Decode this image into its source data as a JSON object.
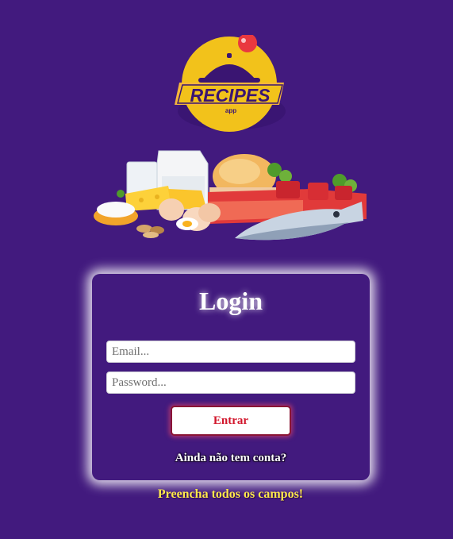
{
  "logo": {
    "title": "RECIPES",
    "subtitle": "app",
    "icon": "cloche-heart-logo"
  },
  "hero": {
    "icon": "food-groceries-illustration"
  },
  "login": {
    "title": "Login",
    "email_placeholder": "Email...",
    "password_placeholder": "Password...",
    "submit_label": "Entrar",
    "signup_text": "Ainda não tem conta?"
  },
  "warning": "Preencha todos os campos!",
  "colors": {
    "background": "#421a7e",
    "logo_yellow": "#f2c21b",
    "button_text": "#d1142a",
    "warning_text": "#ffe94a"
  }
}
